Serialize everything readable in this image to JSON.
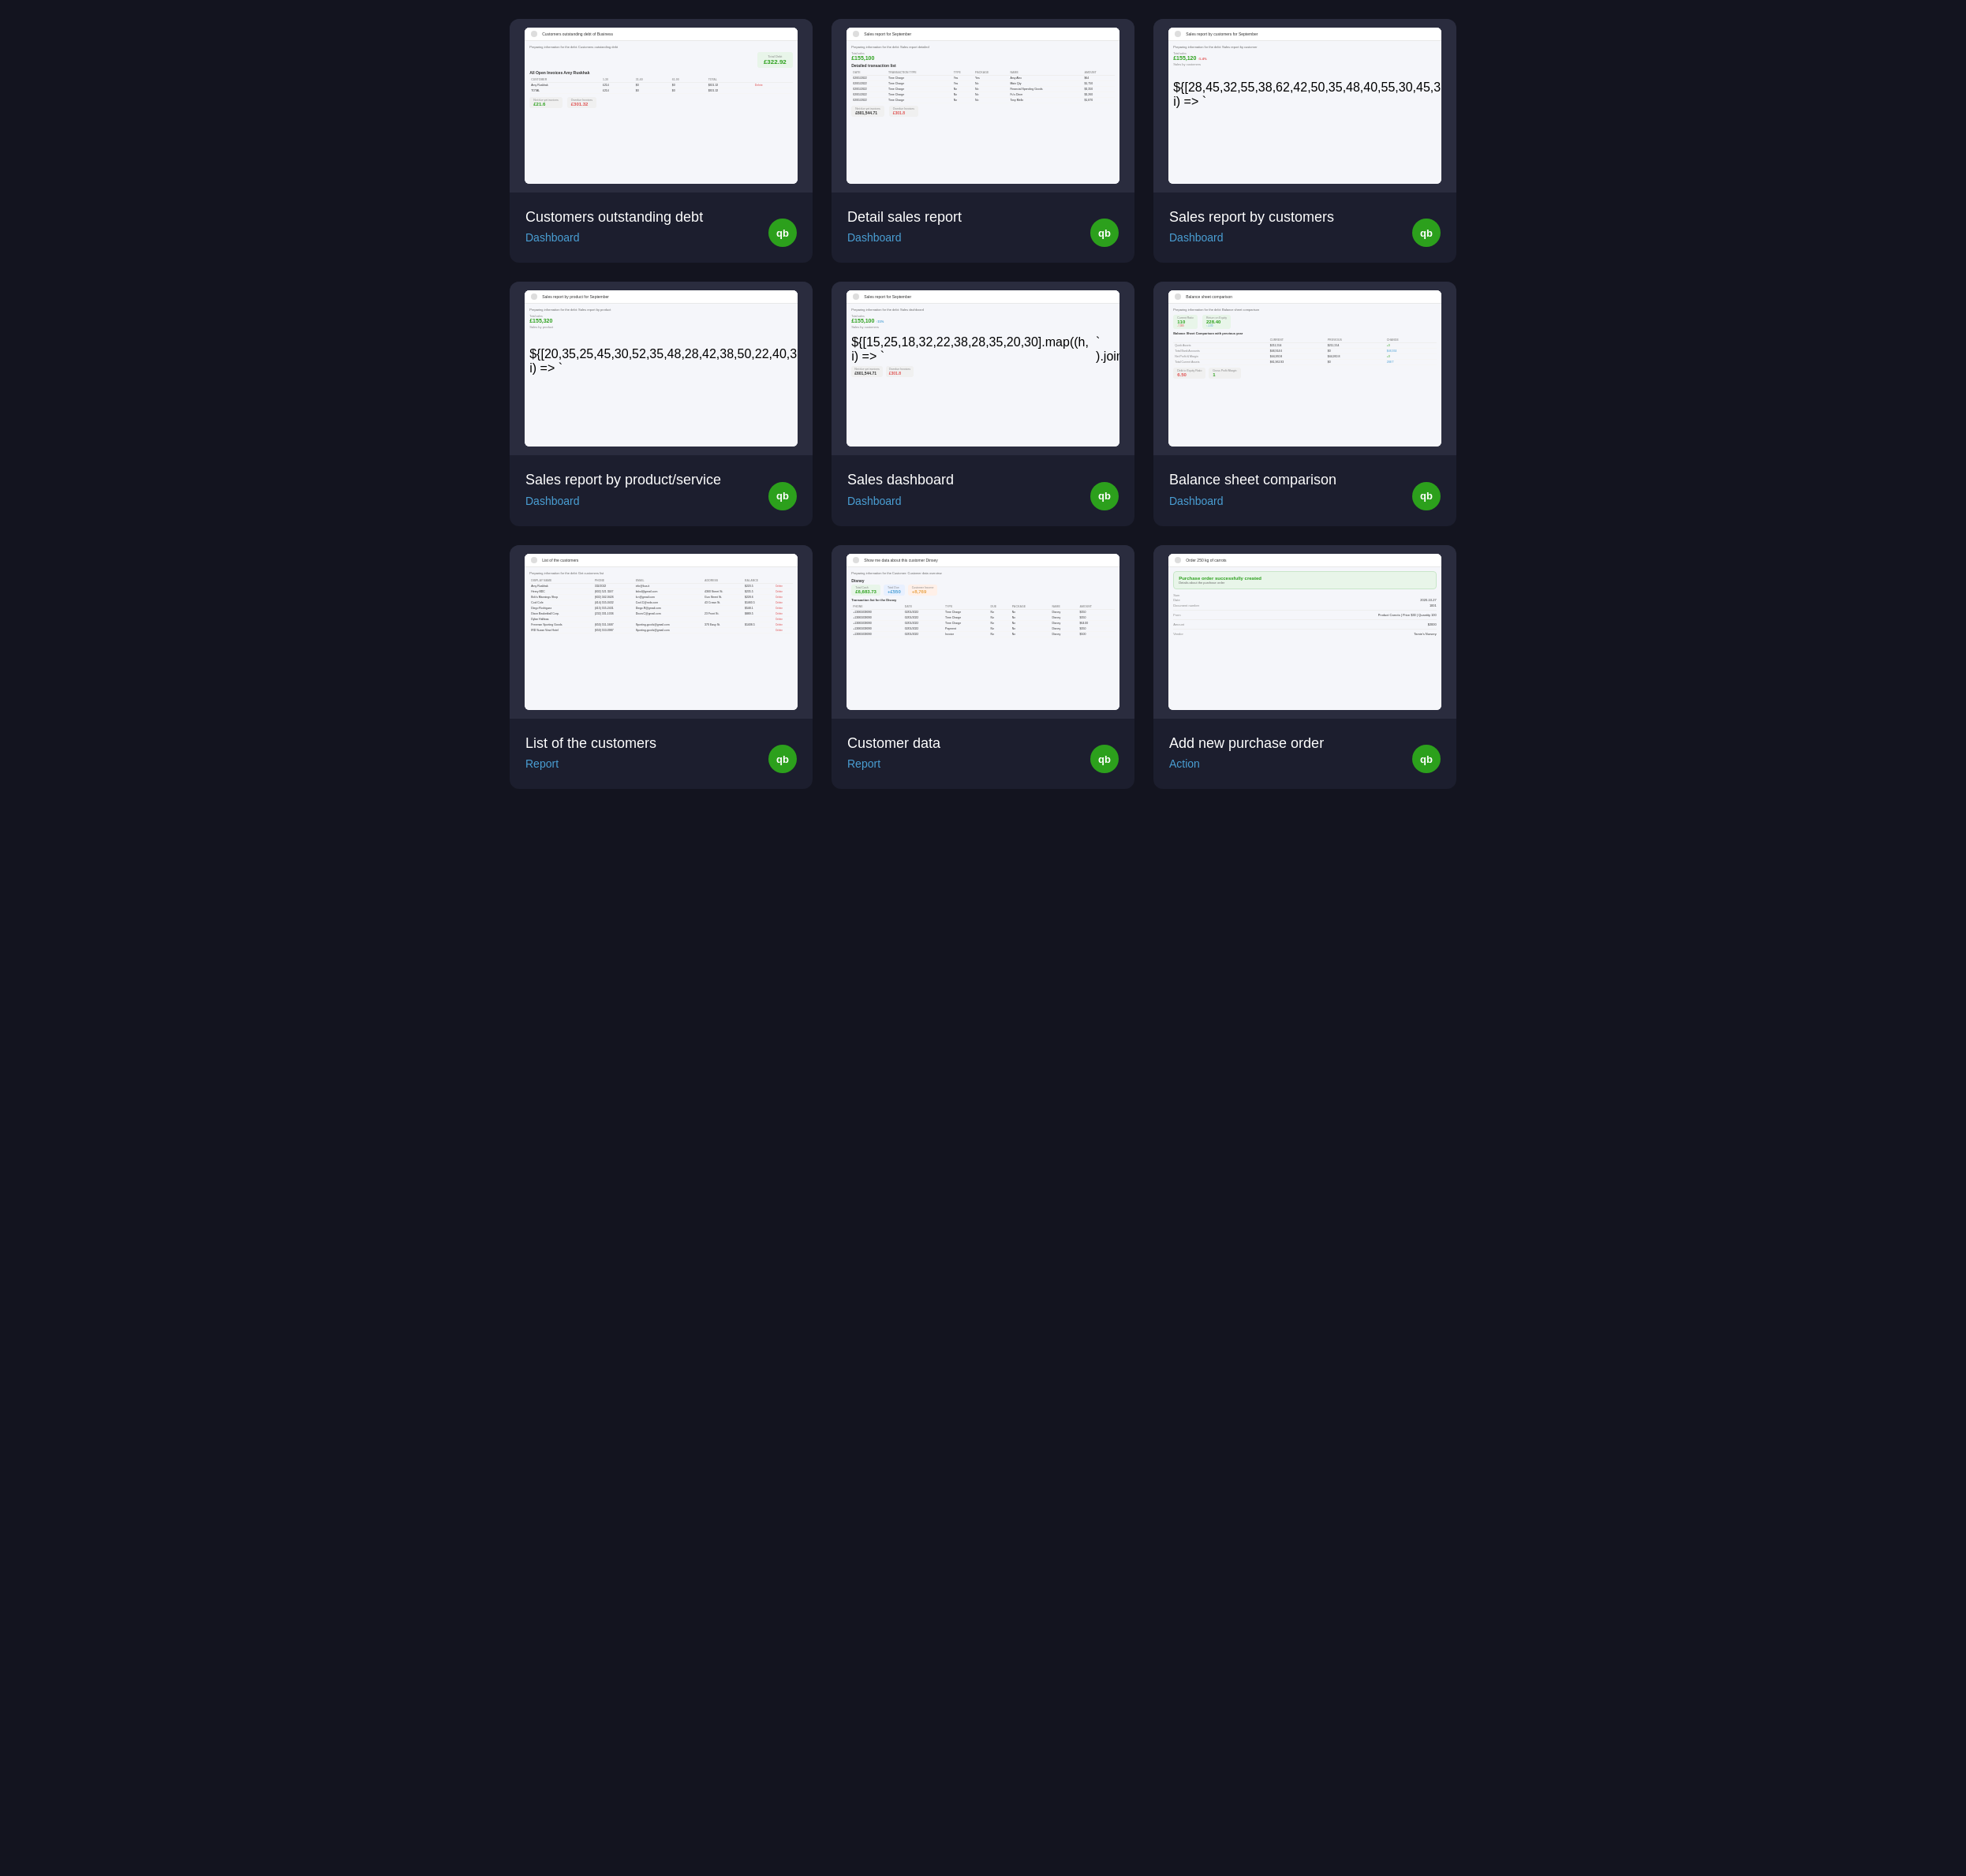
{
  "cards": [
    {
      "id": "customers-outstanding-debt",
      "title": "Customers outstanding debt",
      "type": "Dashboard",
      "type_class": "type-dashboard",
      "preview_type": "table",
      "stat": "£322.92",
      "stat_label": "Total Debt",
      "stat2": "£21.6",
      "stat2_label": "Not due yet invoices"
    },
    {
      "id": "detail-sales-report",
      "title": "Detail sales report",
      "type": "Dashboard",
      "type_class": "type-dashboard",
      "preview_type": "transaction-table",
      "stat": "£155,100",
      "stat_label": "Total sales"
    },
    {
      "id": "sales-report-by-customers",
      "title": "Sales report by customers",
      "type": "Dashboard",
      "type_class": "type-dashboard",
      "preview_type": "bar-chart-table",
      "stat": "£155,120",
      "stat_label": "Total sales"
    },
    {
      "id": "sales-report-by-product",
      "title": "Sales report by product/service",
      "type": "Dashboard",
      "type_class": "type-dashboard",
      "preview_type": "bar-chart-products",
      "stat": "£155,320",
      "stat_label": "Total sales"
    },
    {
      "id": "sales-dashboard",
      "title": "Sales dashboard",
      "type": "Dashboard",
      "type_class": "type-dashboard",
      "preview_type": "sales-dashboard",
      "stat": "£155,100",
      "stat_label": "Total sales"
    },
    {
      "id": "balance-sheet-comparison",
      "title": "Balance sheet comparison",
      "type": "Dashboard",
      "type_class": "type-dashboard",
      "preview_type": "balance-sheet",
      "stat": "110",
      "stat_label": "Current Ratio"
    },
    {
      "id": "list-of-customers",
      "title": "List of the customers",
      "type": "Report",
      "type_class": "type-report",
      "preview_type": "customers-list",
      "stat": ""
    },
    {
      "id": "customer-data",
      "title": "Customer data",
      "type": "Report",
      "type_class": "type-report",
      "preview_type": "customer-data",
      "stat": "£6,683.73",
      "stat_label": "Total Cash"
    },
    {
      "id": "add-new-purchase-order",
      "title": "Add new purchase order",
      "type": "Action",
      "type_class": "type-action",
      "preview_type": "purchase-order",
      "stat": ""
    }
  ],
  "qb_label": "qb"
}
